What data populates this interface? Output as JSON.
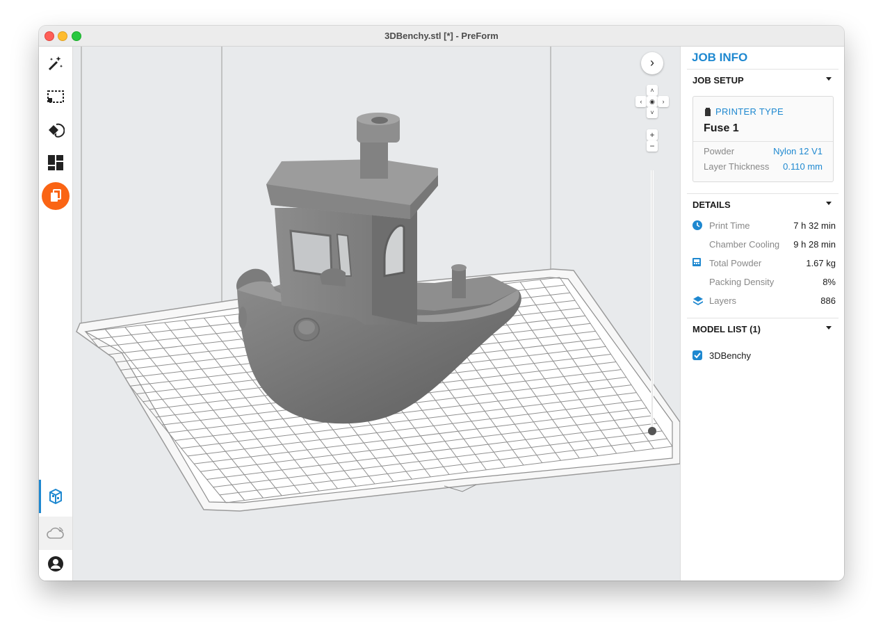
{
  "window": {
    "title": "3DBenchy.stl [*] - PreForm"
  },
  "sidebar": {
    "tools": [
      {
        "name": "magic-wand-icon"
      },
      {
        "name": "select-icon"
      },
      {
        "name": "orient-icon"
      },
      {
        "name": "layout-icon"
      },
      {
        "name": "print-queue-icon",
        "accent": "#fa6414"
      }
    ],
    "bottom": [
      {
        "name": "job-info-icon",
        "active": true
      },
      {
        "name": "cloud-icon"
      },
      {
        "name": "account-icon"
      }
    ]
  },
  "viewport": {
    "model_name": "3DBenchy"
  },
  "panel": {
    "title": "JOB INFO",
    "job_setup": {
      "heading": "JOB SETUP",
      "printer_type_label": "PRINTER TYPE",
      "printer_name": "Fuse 1",
      "rows": [
        {
          "label": "Powder",
          "value": "Nylon 12 V1"
        },
        {
          "label": "Layer Thickness",
          "value": "0.110 mm"
        }
      ]
    },
    "details": {
      "heading": "DETAILS",
      "rows": [
        {
          "label": "Print Time",
          "value": "7 h 32 min",
          "icon": "clock-icon"
        },
        {
          "label": "Chamber Cooling",
          "value": "9 h 28 min",
          "icon": ""
        },
        {
          "label": "Total Powder",
          "value": "1.67 kg",
          "icon": "powder-icon"
        },
        {
          "label": "Packing Density",
          "value": "8%",
          "icon": ""
        },
        {
          "label": "Layers",
          "value": "886",
          "icon": "layers-icon"
        }
      ]
    },
    "model_list": {
      "heading": "MODEL LIST (1)",
      "items": [
        {
          "name": "3DBenchy",
          "checked": true
        }
      ]
    }
  },
  "colors": {
    "accent": "#1e88d0",
    "orange": "#fa6414"
  }
}
